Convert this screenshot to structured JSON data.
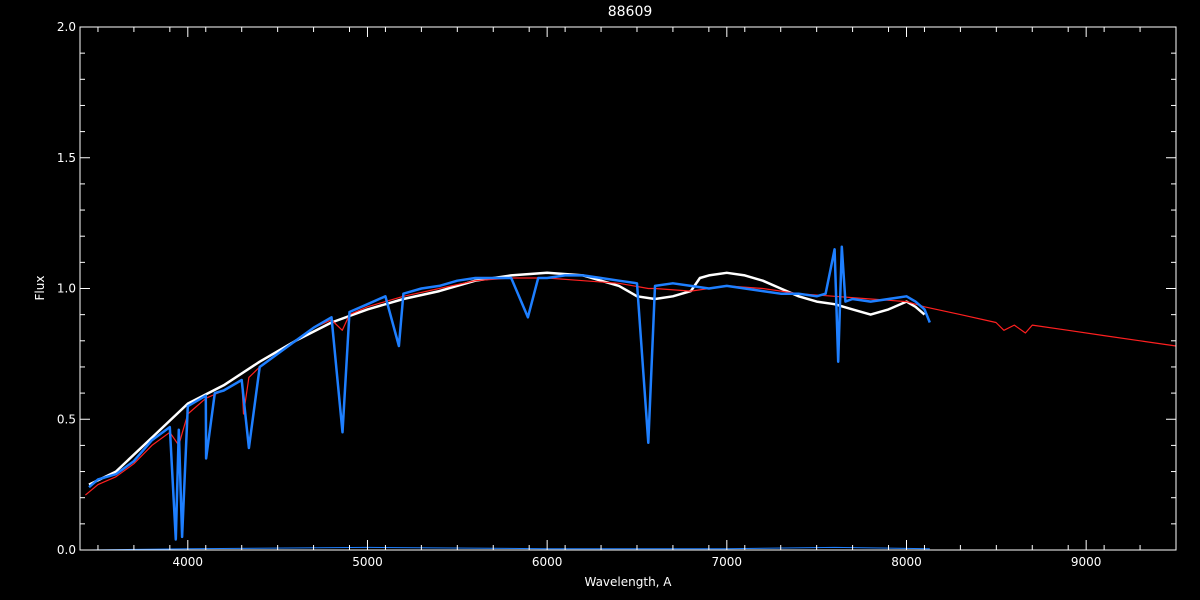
{
  "chart_data": {
    "type": "line",
    "title": "88609",
    "xlabel": "Wavelength, A",
    "ylabel": "Flux",
    "xlim": [
      3400,
      9500
    ],
    "ylim": [
      0.0,
      2.0
    ],
    "x_ticks": [
      4000,
      5000,
      6000,
      7000,
      8000,
      9000
    ],
    "y_ticks": [
      0.0,
      0.5,
      1.0,
      1.5,
      2.0
    ],
    "x_tick_labels": [
      "4000",
      "5000",
      "6000",
      "7000",
      "8000",
      "9000"
    ],
    "y_tick_labels": [
      "0.0",
      "0.5",
      "1.0",
      "1.5",
      "2.0"
    ],
    "grid": false,
    "colors": {
      "white_series": "#ffffff",
      "model": "#ff2020",
      "observed": "#1e7fff",
      "axes": "#ffffff"
    },
    "series": [
      {
        "style": "white",
        "x": [
          3450,
          3600,
          3800,
          4000,
          4200,
          4400,
          4600,
          4800,
          5000,
          5200,
          5400,
          5600,
          5800,
          6000,
          6200,
          6400,
          6450,
          6500,
          6600,
          6700,
          6800,
          6850,
          6900,
          7000,
          7100,
          7200,
          7300,
          7400,
          7500,
          7600,
          7700,
          7800,
          7900,
          8000,
          8050,
          8100
        ],
        "y": [
          0.25,
          0.3,
          0.43,
          0.56,
          0.63,
          0.72,
          0.8,
          0.87,
          0.92,
          0.96,
          0.99,
          1.03,
          1.05,
          1.06,
          1.05,
          1.01,
          0.99,
          0.97,
          0.96,
          0.97,
          0.99,
          1.04,
          1.05,
          1.06,
          1.05,
          1.03,
          1.0,
          0.97,
          0.95,
          0.94,
          0.92,
          0.9,
          0.92,
          0.95,
          0.93,
          0.9
        ]
      },
      {
        "style": "model",
        "x": [
          3430,
          3500,
          3600,
          3700,
          3800,
          3900,
          3950,
          3970,
          4000,
          4100,
          4200,
          4300,
          4310,
          4340,
          4400,
          4500,
          4600,
          4700,
          4800,
          4860,
          4900,
          5000,
          5200,
          5400,
          5600,
          5800,
          6000,
          6200,
          6400,
          6563,
          6600,
          6800,
          7000,
          7200,
          7400,
          7600,
          7800,
          8000,
          8100,
          8300,
          8498,
          8542,
          8600,
          8662,
          8700,
          8900,
          9100,
          9300,
          9500
        ],
        "y": [
          0.21,
          0.25,
          0.28,
          0.33,
          0.4,
          0.45,
          0.4,
          0.45,
          0.52,
          0.58,
          0.61,
          0.65,
          0.52,
          0.66,
          0.7,
          0.75,
          0.8,
          0.85,
          0.88,
          0.84,
          0.9,
          0.93,
          0.97,
          1.0,
          1.03,
          1.04,
          1.04,
          1.03,
          1.02,
          1.0,
          1.0,
          0.99,
          1.01,
          1.0,
          0.98,
          0.97,
          0.96,
          0.95,
          0.93,
          0.9,
          0.87,
          0.84,
          0.86,
          0.83,
          0.86,
          0.84,
          0.82,
          0.8,
          0.78
        ]
      },
      {
        "style": "observed",
        "x": [
          3450,
          3500,
          3600,
          3700,
          3800,
          3900,
          3933,
          3950,
          3968,
          4000,
          4100,
          4102,
          4150,
          4200,
          4300,
          4340,
          4400,
          4500,
          4600,
          4700,
          4800,
          4861,
          4900,
          5000,
          5100,
          5175,
          5200,
          5300,
          5400,
          5500,
          5600,
          5700,
          5800,
          5893,
          5950,
          6000,
          6100,
          6200,
          6300,
          6400,
          6500,
          6563,
          6600,
          6700,
          6800,
          6900,
          7000,
          7100,
          7200,
          7300,
          7400,
          7500,
          7550,
          7600,
          7620,
          7640,
          7660,
          7700,
          7800,
          7900,
          8000,
          8050,
          8100,
          8130
        ],
        "y": [
          0.24,
          0.27,
          0.29,
          0.34,
          0.42,
          0.47,
          0.04,
          0.46,
          0.05,
          0.55,
          0.59,
          0.35,
          0.6,
          0.61,
          0.65,
          0.39,
          0.7,
          0.75,
          0.8,
          0.85,
          0.89,
          0.45,
          0.91,
          0.94,
          0.97,
          0.78,
          0.98,
          1.0,
          1.01,
          1.03,
          1.04,
          1.04,
          1.04,
          0.89,
          1.04,
          1.04,
          1.05,
          1.05,
          1.04,
          1.03,
          1.02,
          0.41,
          1.01,
          1.02,
          1.01,
          1.0,
          1.01,
          1.0,
          0.99,
          0.98,
          0.98,
          0.97,
          0.98,
          1.15,
          0.72,
          1.16,
          0.95,
          0.96,
          0.95,
          0.96,
          0.97,
          0.95,
          0.92,
          0.87
        ]
      },
      {
        "style": "error",
        "x": [
          3450,
          4000,
          5000,
          6000,
          7000,
          7600,
          8130
        ],
        "y": [
          0.0,
          0.005,
          0.01,
          0.005,
          0.005,
          0.01,
          0.005
        ]
      }
    ]
  }
}
